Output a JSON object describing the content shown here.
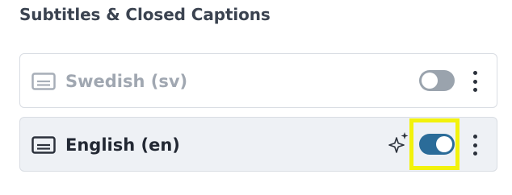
{
  "section": {
    "title": "Subtitles & Closed Captions"
  },
  "tracks": [
    {
      "label": "Swedish (sv)",
      "enabled": false,
      "icon": "closed-captions-icon"
    },
    {
      "label": "English (en)",
      "enabled": true,
      "icon": "closed-captions-icon",
      "badge_icon": "sparkles-icon"
    }
  ],
  "colors": {
    "toggle_on": "#2b6c99",
    "toggle_off": "#9aa3ad",
    "highlight": "#f2f20c"
  }
}
